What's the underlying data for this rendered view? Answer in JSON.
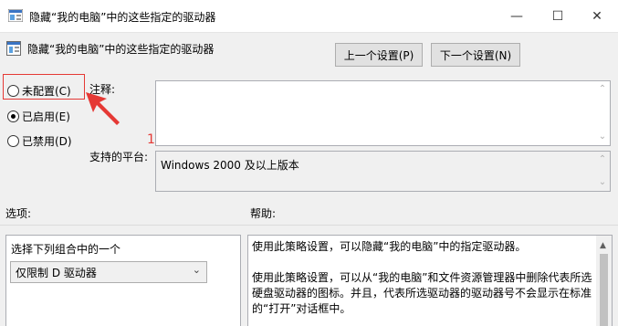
{
  "window": {
    "title": "隐藏“我的电脑”中的这些指定的驱动器",
    "minimize": "—",
    "maximize": "☐",
    "close": "✕"
  },
  "header": {
    "policy_title": "隐藏“我的电脑”中的这些指定的驱动器",
    "prev_button": "上一个设置(P)",
    "next_button": "下一个设置(N)"
  },
  "radios": [
    {
      "label": "未配置(C)",
      "checked": false
    },
    {
      "label": "已启用(E)",
      "checked": true
    },
    {
      "label": "已禁用(D)",
      "checked": false
    }
  ],
  "annotation": {
    "step_number": "1",
    "color": "#e53935"
  },
  "fields": {
    "comment_label": "注释:",
    "comment_value": "",
    "platform_label": "支持的平台:",
    "platform_value": "Windows 2000 及以上版本"
  },
  "sections": {
    "options_label": "选项:",
    "help_label": "帮助:"
  },
  "options": {
    "combo_label": "选择下列组合中的一个",
    "selected_value": "仅限制 D 驱动器"
  },
  "help": {
    "paragraphs": [
      "使用此策略设置，可以隐藏“我的电脑”中的指定驱动器。",
      "使用此策略设置，可以从“我的电脑”和文件资源管理器中删除代表所选硬盘驱动器的图标。并且，代表所选驱动器的驱动器号不会显示在标准的“打开”对话框中。"
    ]
  }
}
